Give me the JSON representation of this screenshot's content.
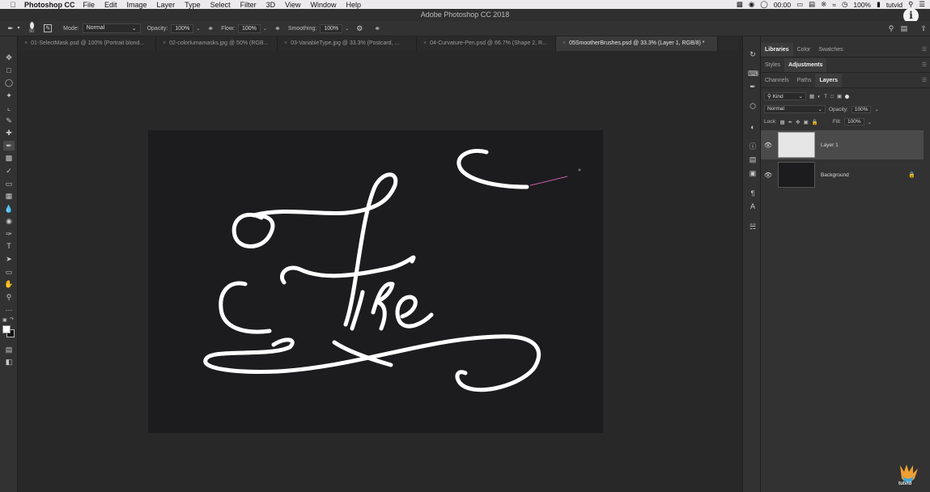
{
  "menubar": {
    "app": "Photoshop CC",
    "items": [
      "File",
      "Edit",
      "Image",
      "Layer",
      "Type",
      "Select",
      "Filter",
      "3D",
      "View",
      "Window",
      "Help"
    ],
    "status": {
      "time_recording": "00:00",
      "battery": "100%",
      "user": "tutvid"
    }
  },
  "window_title": "Adobe Photoshop CC 2018",
  "options": {
    "brush_size": "50",
    "mode_label": "Mode:",
    "mode_value": "Normal",
    "opacity_label": "Opacity:",
    "opacity_value": "100%",
    "flow_label": "Flow:",
    "flow_value": "100%",
    "smoothing_label": "Smoothing:",
    "smoothing_value": "100%"
  },
  "tabs": [
    {
      "label": "01-SelectMask.psd @ 100% (Portrait  blond..."
    },
    {
      "label": "02-colorlumamasks.jpg @ 50% (RGB..."
    },
    {
      "label": "03-VariableType.jpg @ 33.3% (Postcard, ..."
    },
    {
      "label": "04-Curvature-Pen.psd @ 66.7% (Shape 2, R..."
    },
    {
      "label": "05SmootherBrushes.psd @ 33.3% (Layer 1, RGB/8) *"
    }
  ],
  "panels": {
    "top_tabs": [
      "Libraries",
      "Color",
      "Swatches"
    ],
    "mid_tabs": [
      "Styles",
      "Adjustments"
    ],
    "layer_tabs": [
      "Channels",
      "Paths",
      "Layers"
    ],
    "kind_filter": "Kind",
    "blend_mode": "Normal",
    "opacity_label": "Opacity:",
    "opacity_value": "100%",
    "lock_label": "Lock:",
    "fill_label": "Fill:",
    "fill_value": "100%",
    "layers": [
      {
        "name": "Layer 1"
      },
      {
        "name": "Background"
      }
    ]
  },
  "canvas_text": "Fire",
  "watermark": "tutvid",
  "colors": {
    "canvas": "#1c1b1d",
    "app_bg": "#282828",
    "panel": "#323232",
    "stroke": "#ffffff",
    "accent_stroke": "#c15fa8"
  }
}
